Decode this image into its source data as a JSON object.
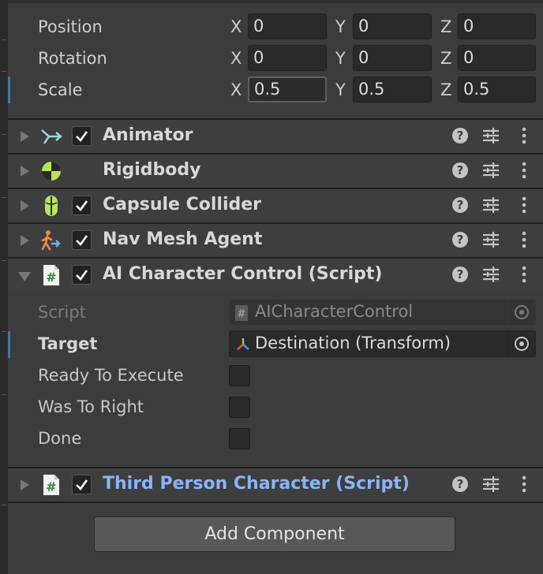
{
  "transform": {
    "rows": [
      {
        "label": "Position",
        "x": "0",
        "y": "0",
        "z": "0"
      },
      {
        "label": "Rotation",
        "x": "0",
        "y": "0",
        "z": "0"
      },
      {
        "label": "Scale",
        "x": "0.5",
        "y": "0.5",
        "z": "0.5"
      }
    ],
    "axis_x": "X",
    "axis_y": "Y",
    "axis_z": "Z"
  },
  "components": [
    {
      "title": "Animator",
      "icon": "animator-icon",
      "enabled": true
    },
    {
      "title": "Rigidbody",
      "icon": "rigidbody-icon",
      "enabled": null
    },
    {
      "title": "Capsule Collider",
      "icon": "capsule-collider-icon",
      "enabled": true
    },
    {
      "title": "Nav Mesh Agent",
      "icon": "nav-mesh-agent-icon",
      "enabled": true
    },
    {
      "title": "AI Character Control (Script)",
      "icon": "script-icon",
      "enabled": true,
      "expanded": true
    },
    {
      "title": "Third Person Character (Script)",
      "icon": "script-icon",
      "enabled": true,
      "accent": "#8ab4f8"
    }
  ],
  "script_fields": {
    "script_label": "Script",
    "script_value": "AICharacterControl",
    "target_label": "Target",
    "target_value": "Destination (Transform)",
    "bools": [
      {
        "label": "Ready To Execute",
        "value": false
      },
      {
        "label": "Was To Right",
        "value": false
      },
      {
        "label": "Done",
        "value": false
      }
    ]
  },
  "add_component_label": "Add Component",
  "colors": {
    "accent": "#3a79bb",
    "script_title": "#8ab4f8",
    "checkmark": "#ffffff"
  }
}
